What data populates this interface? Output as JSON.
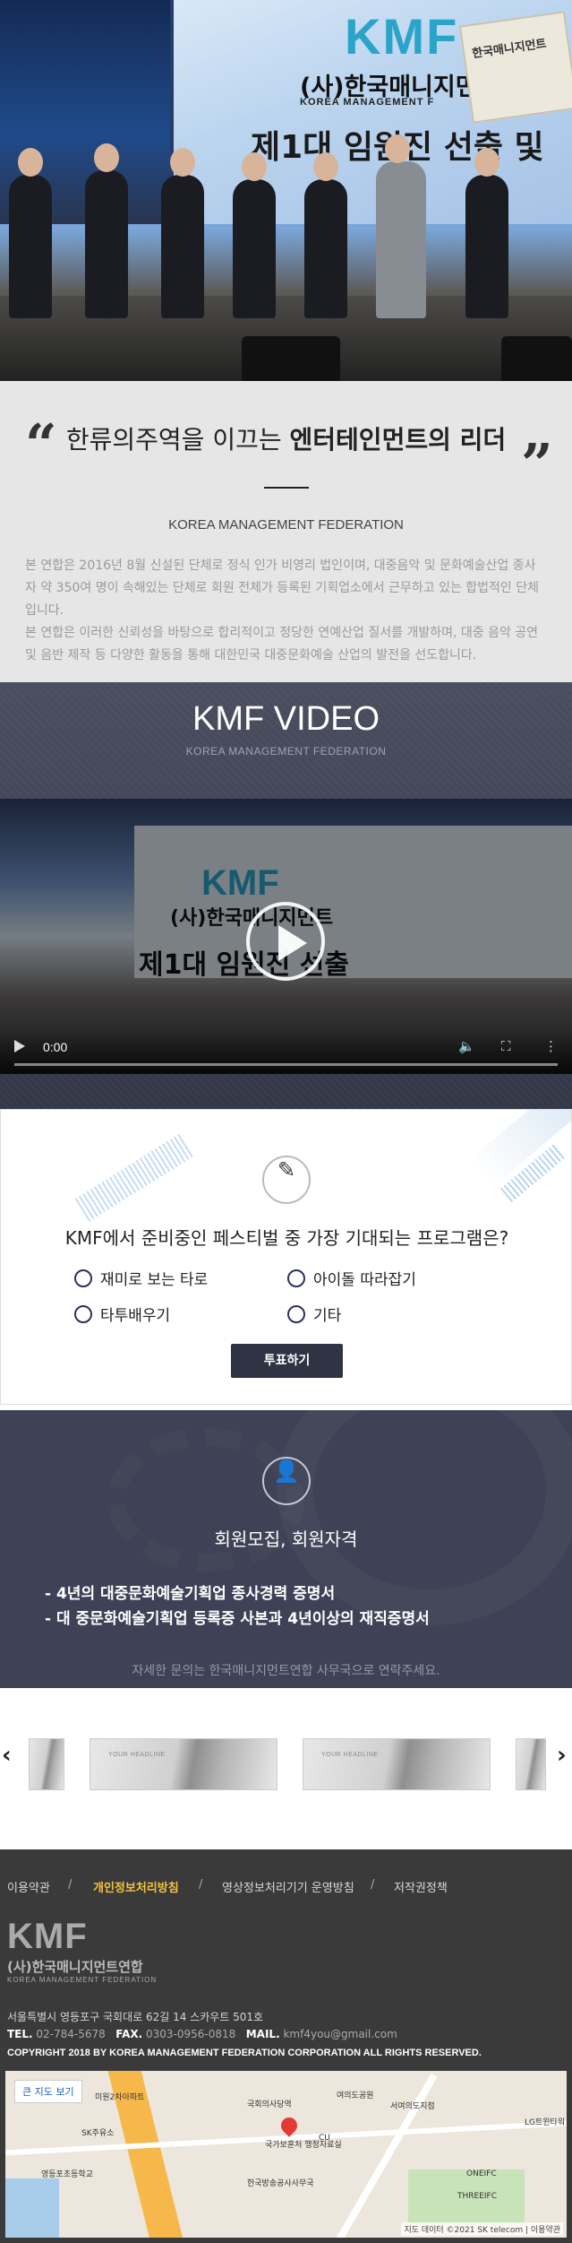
{
  "hero": {
    "screen_logo": "KMF",
    "screen_org": "(사)한국매니지먼트",
    "screen_org_en": "KOREA MANAGEMENT F",
    "screen_banner": "제1대 임원진 선출 및",
    "flag_text": "한국매니지먼트"
  },
  "intro": {
    "heading_plain": "한류의주역을 이끄는 ",
    "heading_bold": "엔터테인먼트의 리더",
    "quote_open": "“",
    "quote_close": "”",
    "subhead": "KOREA MANAGEMENT FEDERATION",
    "body": "본 연합은 2016년 8월 신설된 단체로 정식 인가 비영리 법인이며, 대중음악 및 문화예술산업 종사자 약 350여 명이 속해있는 단체로 회원 전체가 등록된 기획업소에서 근무하고 있는 합법적인 단체입니다.",
    "body2": "본 연합은 이러한 신뢰성을 바탕으로 합리적이고 정당한 연예산업 질서를 개발하며, 대중 음악 공연 및 음반 제작 등 다양한 활동을 통해 대한민국 대중문화예술 산업의 발전을 선도합니다."
  },
  "video": {
    "title": "KMF VIDEO",
    "subtitle": "KOREA MANAGEMENT FEDERATION",
    "frame_logo": "KMF",
    "frame_org": "(사)한국매니지먼트",
    "frame_banner": "제1대 임원진 선출",
    "time": "0:00"
  },
  "poll": {
    "question": "KMF에서 준비중인 페스티벌 중 가장 기대되는 프로그램은?",
    "options": [
      "재미로 보는 타로",
      "아이돌 따라잡기",
      "타투배우기",
      "기타"
    ],
    "vote_label": "투표하기"
  },
  "membership": {
    "title": "회원모집, 회원자격",
    "items": [
      "- 4년의 대중문화예술기획업 종사경력 증명서",
      "- 대 중문화예술기획업 등록증 사본과 4년이상의 재직증명서"
    ],
    "note": "자세한 문의는 한국매니지먼트연합 사무국으로 연락주세요."
  },
  "carousel": {
    "slide_headline": "YOUR HEADLINE",
    "prev_icon": "chevron-left-icon",
    "next_icon": "chevron-right-icon"
  },
  "footer": {
    "nav": [
      "이용약관",
      "개인정보처리방침",
      "영상정보처리기기 운영방침",
      "저작권정책"
    ],
    "separator": "/",
    "logo_mark": "KMF",
    "logo_kr": "(사)한국매니지먼트연합",
    "logo_en": "KOREA MANAGEMENT FEDERATION",
    "address": "서울특별시 영등포구 국회대로 62길 14 스카우트 501호",
    "tel_label": "TEL.",
    "tel": "02-784-5678",
    "fax_label": "FAX.",
    "fax": "0303-0956-0818",
    "mail_label": "MAIL.",
    "mail": "kmf4you@gmail.com",
    "copyright": "COPYRIGHT 2018 BY KOREA MANAGEMENT FEDERATION CORPORATION ALL RIGHTS RESERVED."
  },
  "map": {
    "big_map_button": "큰 지도 보기",
    "labels": [
      "국회의사당역",
      "여의도공원",
      "국가보훈처 행정자료실",
      "한국방송공사사무국",
      "영등포초등학교",
      "SK주유소",
      "미원2차아파트",
      "ONEIFC",
      "THREEIFC",
      "LG트윈타워",
      "CU",
      "서여의도지점"
    ],
    "credit": "지도 데이터 ©2021 SK telecom | 이용약관"
  },
  "colors": {
    "accent_yellow": "#f5c33b",
    "dark_navy": "#3f4256",
    "vote_button": "#2f3344",
    "footer_bg": "#3a3a3a"
  }
}
